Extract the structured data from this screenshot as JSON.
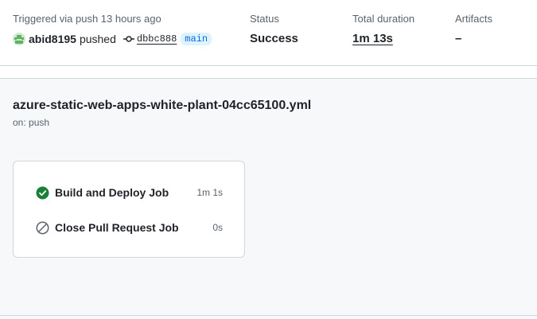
{
  "summary": {
    "trigger_label": "Triggered via push 13 hours ago",
    "actor": "abid8195",
    "action": "pushed",
    "commit_sha": "dbbc888",
    "branch": "main",
    "status_label": "Status",
    "status_value": "Success",
    "duration_label": "Total duration",
    "duration_value": "1m 13s",
    "artifacts_label": "Artifacts",
    "artifacts_value": "–"
  },
  "workflow": {
    "file_name": "azure-static-web-apps-white-plant-04cc65100.yml",
    "trigger": "on: push"
  },
  "jobs": [
    {
      "name": "Build and Deploy Job",
      "duration": "1m 1s",
      "status_icon": "check-circle-icon",
      "status_color": "#1a7f37"
    },
    {
      "name": "Close Pull Request Job",
      "duration": "0s",
      "status_icon": "skipped-icon",
      "status_color": "#59636e"
    }
  ],
  "colors": {
    "success": "#1a7f37",
    "branch_text": "#0969da",
    "branch_bg": "#ddf4ff",
    "muted": "#59636e"
  }
}
